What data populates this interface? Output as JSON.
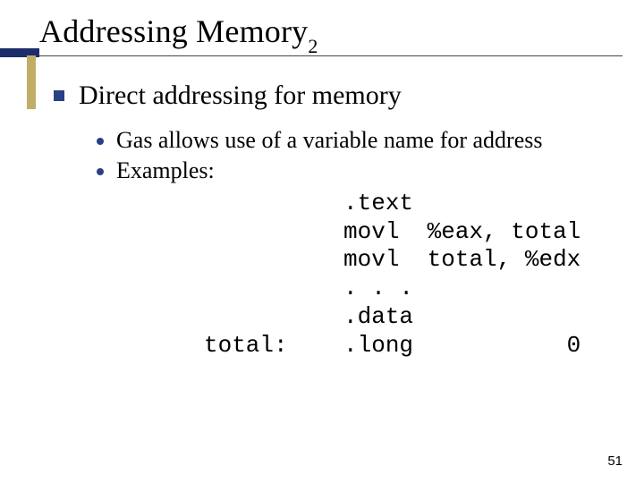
{
  "slide": {
    "title_main": "Addressing Memory",
    "title_sub": "2",
    "level1": "Direct addressing for memory",
    "level2": {
      "a": "Gas allows use of a variable name for address",
      "b": "Examples:"
    },
    "code": "          .text\n          movl  %eax, total\n          movl  total, %edx\n          . . .\n          .data\ntotal:    .long           0",
    "page_number": "51"
  }
}
